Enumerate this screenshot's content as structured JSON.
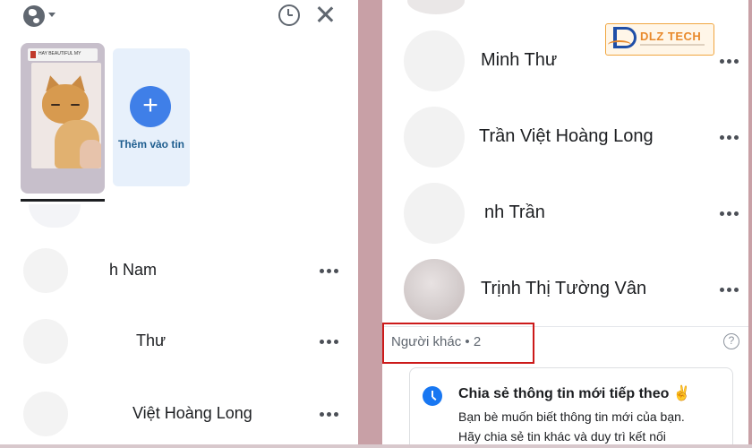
{
  "left_panel": {
    "story": {
      "header_text": "HAY BEAUTIFUL MY",
      "add_label": "Thêm vào tin",
      "add_symbol": "+"
    },
    "items": [
      {
        "name": "h Nam"
      },
      {
        "name": "Thư"
      },
      {
        "name": "Việt Hoàng Long"
      }
    ]
  },
  "right_panel": {
    "items": [
      {
        "name": "Minh Thư"
      },
      {
        "name": "Trần Việt Hoàng Long"
      },
      {
        "name": "nh Trần"
      },
      {
        "name": "Trịnh Thị Tường Vân"
      }
    ],
    "other_section": {
      "label": "Người khác • 2",
      "help_symbol": "?"
    },
    "info_card": {
      "title": "Chia sẻ thông tin mới tiếp theo ✌️",
      "line1": "Bạn bè muốn biết thông tin mới của bạn.",
      "line2": "Hãy chia sẻ tin khác và duy trì kết nối"
    }
  },
  "logo": {
    "text": "DLZ TECH"
  },
  "colors": {
    "accent_blue": "#3f7fe8",
    "highlight_red": "#cc1a1a",
    "divider": "#c8a0a6"
  }
}
